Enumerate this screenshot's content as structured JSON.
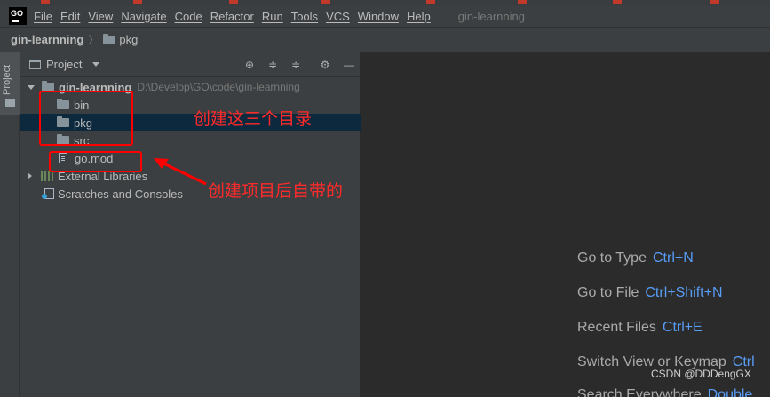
{
  "menu": {
    "items": [
      "File",
      "Edit",
      "View",
      "Navigate",
      "Code",
      "Refactor",
      "Run",
      "Tools",
      "VCS",
      "Window",
      "Help"
    ],
    "window_title": "gin-learnning",
    "logo_text": "GO"
  },
  "breadcrumb": {
    "root": "gin-learnning",
    "leaf": "pkg"
  },
  "tool_strip": {
    "project_tab": "Project"
  },
  "project_panel": {
    "title": "Project",
    "root": {
      "name": "gin-learnning",
      "path": "D:\\Develop\\GO\\code\\gin-learnning"
    },
    "folders": [
      "bin",
      "pkg",
      "src"
    ],
    "file": "go.mod",
    "external": "External Libraries",
    "scratches": "Scratches and Consoles"
  },
  "annotations": {
    "dirs": "创建这三个目录",
    "auto": "创建项目后自带的"
  },
  "editor": {
    "hints": [
      {
        "label": "Go to Type",
        "shortcut": "Ctrl+N"
      },
      {
        "label": "Go to File",
        "shortcut": "Ctrl+Shift+N"
      },
      {
        "label": "Recent Files",
        "shortcut": "Ctrl+E"
      },
      {
        "label": "Switch View or Keymap",
        "shortcut": "Ctrl"
      },
      {
        "label": "Search Everywhere",
        "shortcut": "Double"
      }
    ],
    "watermark": "CSDN @DDDengGX"
  },
  "colors": {
    "accent": "#589df6",
    "annotation": "#ff0000",
    "selection": "#0d293e"
  }
}
